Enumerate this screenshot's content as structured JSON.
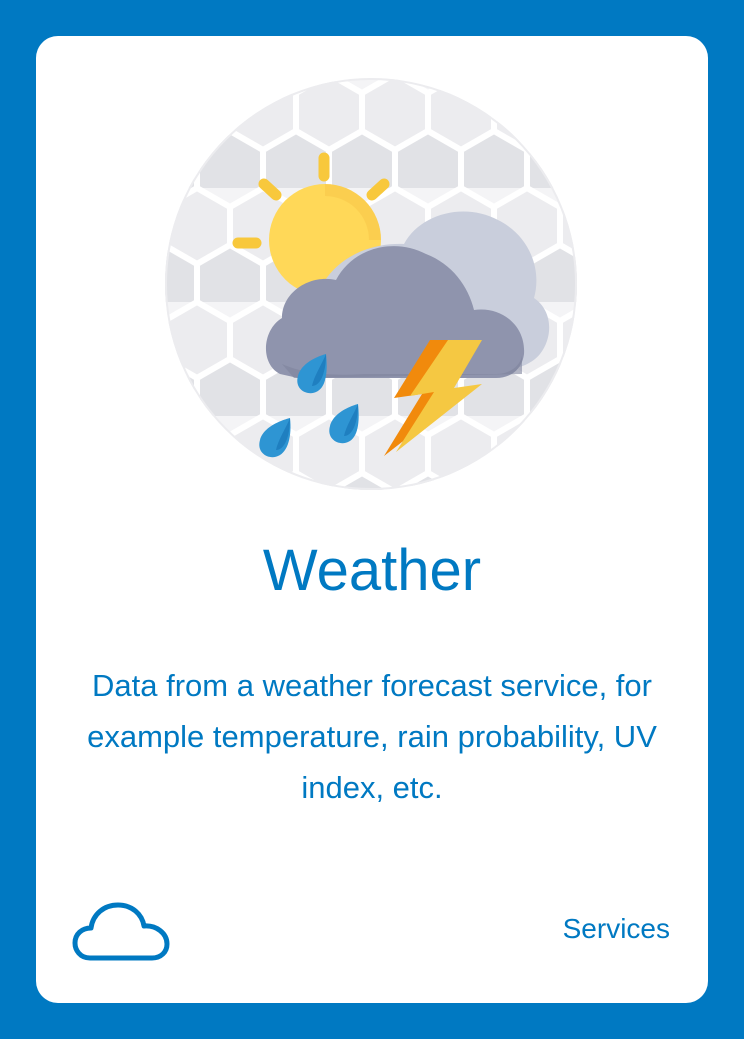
{
  "card": {
    "title": "Weather",
    "description": "Data from a weather forecast service, for example temperature, rain probability, UV index, etc.",
    "category_label": "Services",
    "category_icon": "cloud-outline-icon",
    "illustration_icon": "storm-weather-icon"
  },
  "colors": {
    "page_background": "#0079c2",
    "card_background": "#ffffff",
    "text": "#0079c2",
    "sun": "#ffd858",
    "sun_rays": "#f8c83c",
    "cloud_back": "#c9cedc",
    "cloud_front": "#8f94ad",
    "lightning_front": "#f5c842",
    "lightning_back": "#f18a0c",
    "raindrop": "#2e95d3"
  }
}
